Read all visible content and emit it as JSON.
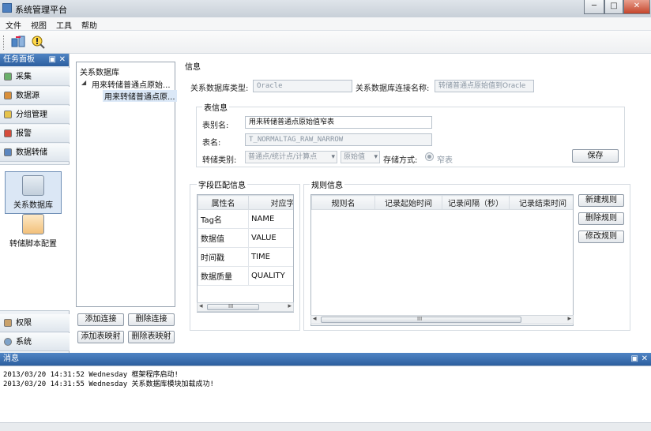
{
  "window": {
    "title": "系统管理平台",
    "minimize": "─",
    "maximize": "□",
    "close": "✕"
  },
  "menu": [
    "文件",
    "视图",
    "工具",
    "帮助"
  ],
  "task_panel": {
    "title": "任务面板",
    "pin": "▣",
    "close": "✕",
    "items": [
      "采集",
      "数据源",
      "分组管理",
      "报警",
      "数据转储"
    ],
    "tools": [
      "关系数据库",
      "转储脚本配置"
    ],
    "bottom_items": [
      "权限",
      "系统"
    ]
  },
  "tree": {
    "root": "关系数据库",
    "node": "用来转储普通点原始...",
    "child": "用来转储普通点原..."
  },
  "tree_buttons": {
    "add_conn": "添加连接",
    "del_conn": "删除连接",
    "add_map": "添加表映射",
    "del_map": "删除表映射"
  },
  "info": {
    "title": "信息",
    "db_type_label": "关系数据库类型:",
    "db_type_value": "Oracle",
    "conn_name_label": "关系数据库连接名称:",
    "conn_name_value": "转储普通点原始值到Oracle"
  },
  "table_info": {
    "title": "表信息",
    "alias_label": "表别名:",
    "alias_value": "用来转储普通点原始值窄表",
    "table_label": "表名:",
    "table_value": "T_NORMALTAG_RAW_NARROW",
    "dump_type_label": "转储类别:",
    "dump_type_value": "普通点/统计点/计算点",
    "value_type": "原始值",
    "storage_label": "存储方式:",
    "storage_value": "窄表",
    "save": "保存"
  },
  "field_mapping": {
    "title": "字段匹配信息",
    "columns": [
      "属性名",
      "对应字段"
    ],
    "rows": [
      [
        "Tag名",
        "NAME"
      ],
      [
        "数据值",
        "VALUE"
      ],
      [
        "时间戳",
        "TIME"
      ],
      [
        "数据质量",
        "QUALITY"
      ]
    ],
    "scroll_left": "◂",
    "scroll_right": "▸",
    "scroll_grip": "III"
  },
  "rules": {
    "title": "规则信息",
    "columns": [
      "规则名",
      "记录起始时间",
      "记录间隔（秒）",
      "记录结束时间"
    ],
    "new": "新建规则",
    "delete": "删除规则",
    "modify": "修改规则",
    "scroll_left": "◂",
    "scroll_right": "▸",
    "scroll_grip": "III"
  },
  "messages": {
    "title": "消息",
    "pin": "▣",
    "close": "✕",
    "lines": [
      "2013/03/20 14:31:52 Wednesday 框架程序启动!",
      "2013/03/20 14:31:55 Wednesday 关系数据库模块加载成功!"
    ]
  },
  "icons": {
    "toolbar": [
      "connect-icon",
      "warning-icon"
    ]
  },
  "colors": {
    "panel_header": "#3a6fb2",
    "title_bar": "#d3d9df"
  }
}
